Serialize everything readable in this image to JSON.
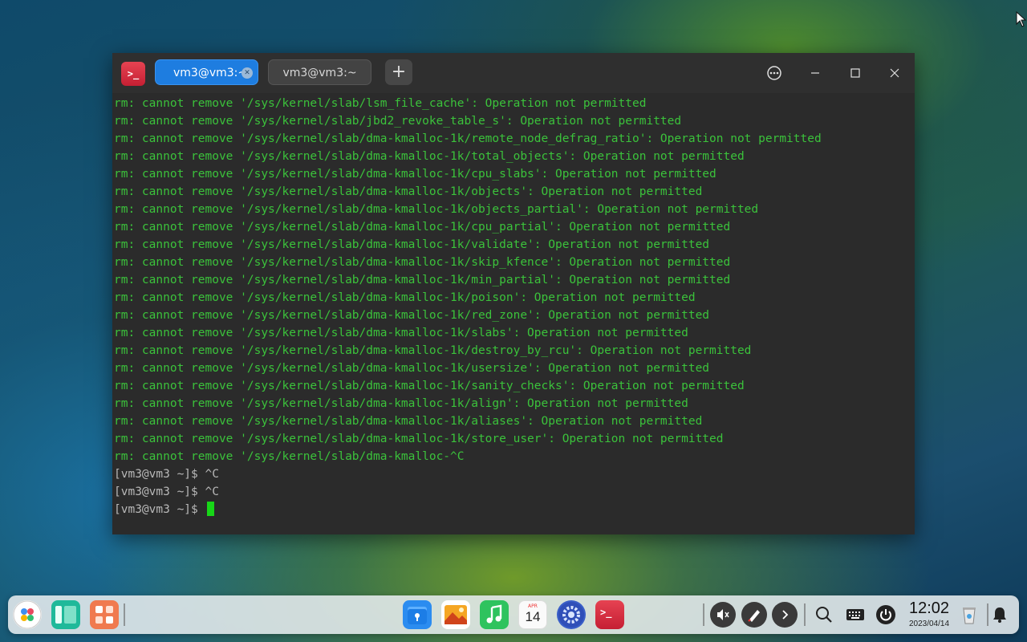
{
  "window": {
    "tabs": [
      {
        "label": "vm3@vm3:~",
        "active": true
      },
      {
        "label": "vm3@vm3:~",
        "active": false
      }
    ],
    "new_tab_label": "+",
    "app_logo_text": ">_"
  },
  "terminal": {
    "lines": [
      "rm: cannot remove '/sys/kernel/slab/lsm_file_cache': Operation not permitted",
      "rm: cannot remove '/sys/kernel/slab/jbd2_revoke_table_s': Operation not permitted",
      "rm: cannot remove '/sys/kernel/slab/dma-kmalloc-1k/remote_node_defrag_ratio': Operation not permitted",
      "rm: cannot remove '/sys/kernel/slab/dma-kmalloc-1k/total_objects': Operation not permitted",
      "rm: cannot remove '/sys/kernel/slab/dma-kmalloc-1k/cpu_slabs': Operation not permitted",
      "rm: cannot remove '/sys/kernel/slab/dma-kmalloc-1k/objects': Operation not permitted",
      "rm: cannot remove '/sys/kernel/slab/dma-kmalloc-1k/objects_partial': Operation not permitted",
      "rm: cannot remove '/sys/kernel/slab/dma-kmalloc-1k/cpu_partial': Operation not permitted",
      "rm: cannot remove '/sys/kernel/slab/dma-kmalloc-1k/validate': Operation not permitted",
      "rm: cannot remove '/sys/kernel/slab/dma-kmalloc-1k/skip_kfence': Operation not permitted",
      "rm: cannot remove '/sys/kernel/slab/dma-kmalloc-1k/min_partial': Operation not permitted",
      "rm: cannot remove '/sys/kernel/slab/dma-kmalloc-1k/poison': Operation not permitted",
      "rm: cannot remove '/sys/kernel/slab/dma-kmalloc-1k/red_zone': Operation not permitted",
      "rm: cannot remove '/sys/kernel/slab/dma-kmalloc-1k/slabs': Operation not permitted",
      "rm: cannot remove '/sys/kernel/slab/dma-kmalloc-1k/destroy_by_rcu': Operation not permitted",
      "rm: cannot remove '/sys/kernel/slab/dma-kmalloc-1k/usersize': Operation not permitted",
      "rm: cannot remove '/sys/kernel/slab/dma-kmalloc-1k/sanity_checks': Operation not permitted",
      "rm: cannot remove '/sys/kernel/slab/dma-kmalloc-1k/align': Operation not permitted",
      "rm: cannot remove '/sys/kernel/slab/dma-kmalloc-1k/aliases': Operation not permitted",
      "rm: cannot remove '/sys/kernel/slab/dma-kmalloc-1k/store_user': Operation not permitted",
      "rm: cannot remove '/sys/kernel/slab/dma-kmalloc-^C"
    ],
    "prompts": [
      "[vm3@vm3 ~]$ ^C",
      "[vm3@vm3 ~]$ ^C",
      "[vm3@vm3 ~]$ "
    ],
    "text_color": "#3bc23b",
    "cursor_color": "#17d617"
  },
  "dock": {
    "apps": [
      {
        "name": "launcher-icon"
      },
      {
        "name": "multitasking-icon"
      },
      {
        "name": "app-store-icon"
      },
      {
        "name": "file-manager-icon"
      },
      {
        "name": "image-viewer-icon"
      },
      {
        "name": "music-icon"
      },
      {
        "name": "calendar-icon"
      },
      {
        "name": "settings-icon"
      },
      {
        "name": "terminal-icon"
      }
    ],
    "calendar_day": "14",
    "clock": {
      "time": "12:02",
      "date": "2023/04/14"
    }
  }
}
